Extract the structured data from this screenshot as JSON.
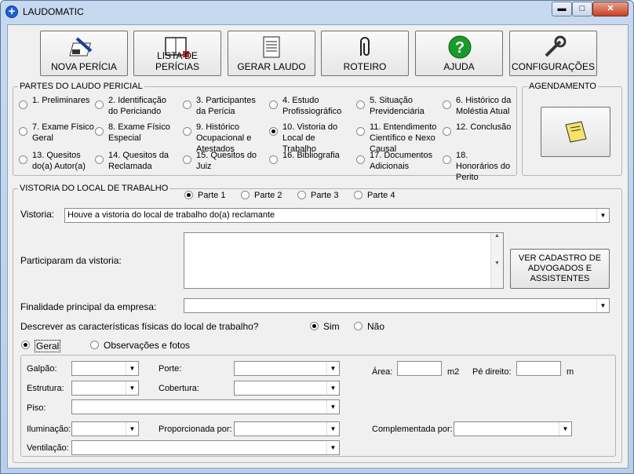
{
  "window": {
    "title": "LAUDOMATIC",
    "minimize": "▬",
    "maximize": "□",
    "close": "✕"
  },
  "toolbar": [
    {
      "label": "NOVA PERÍCIA",
      "icon": "pen-writing-icon"
    },
    {
      "label": "LISTA DE PERÍCIAS",
      "icon": "book-list-icon"
    },
    {
      "label": "GERAR LAUDO",
      "icon": "document-icon"
    },
    {
      "label": "ROTEIRO",
      "icon": "paperclip-icon"
    },
    {
      "label": "AJUDA",
      "icon": "help-icon"
    },
    {
      "label": "CONFIGURAÇÕES",
      "icon": "wrench-icon"
    }
  ],
  "partes": {
    "title": "PARTES DO LAUDO PERICIAL",
    "items": [
      "1. Preliminares",
      "2. Identificação do Periciando",
      "3. Participantes da Perícia",
      "4. Estudo Profissiográfico",
      "5. Situação Previdenciária",
      "6. Histórico da Moléstia Atual",
      "7. Exame Físico Geral",
      "8. Exame Físico Especial",
      "9. Histórico Ocupacional e Atestados",
      "10. Vistoria do Local de Trabalho",
      "11. Entendimento Científico e Nexo Causal",
      "12. Conclusão",
      "13. Quesitos do(a) Autor(a)",
      "14. Quesitos da Reclamada",
      "15. Quesitos do Juiz",
      "16. Bibliografia",
      "17. Documentos Adicionais",
      "18. Honorários do Perito"
    ],
    "selected": "10. Vistoria do Local de Trabalho"
  },
  "agendamento": {
    "title": "AGENDAMENTO",
    "icon": "notepad-icon"
  },
  "vistoria": {
    "title": "VISTORIA DO LOCAL DE TRABALHO",
    "parts": [
      "Parte 1",
      "Parte 2",
      "Parte 3",
      "Parte 4"
    ],
    "selected_part": "Parte 1",
    "vistoria_label": "Vistoria:",
    "vistoria_value": "Houve a vistoria do local de trabalho do(a) reclamante",
    "participaram_label": "Participaram da vistoria:",
    "participaram_value": "",
    "cadastro_button": "VER CADASTRO DE ADVOGADOS E ASSISTENTES",
    "finalidade_label": "Finalidade principal da empresa:",
    "finalidade_value": "",
    "descrever_label": "Descrever as características físicas do local de trabalho?",
    "sim": "Sim",
    "nao": "Não",
    "descrever_selected": "Sim",
    "geral": "Geral",
    "observacoes": "Observações e fotos",
    "view_selected": "Geral",
    "fields": {
      "galpao": "Galpão:",
      "porte": "Porte:",
      "area": "Área:",
      "area_unit": "m2",
      "pe_direito": "Pé direito:",
      "pe_unit": "m",
      "estrutura": "Estrutura:",
      "cobertura": "Cobertura:",
      "piso": "Piso:",
      "iluminacao": "Iluminação:",
      "proporcionada": "Proporcionada por:",
      "complementada": "Complementada por:",
      "ventilacao": "Ventilação:"
    }
  }
}
